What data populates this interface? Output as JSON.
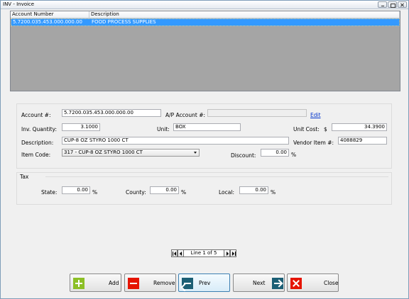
{
  "window": {
    "title": "INV - Invoice"
  },
  "grid": {
    "columns": [
      "Account Number",
      "Description"
    ],
    "rows": [
      {
        "account_number": "5.7200.035.453.000.000.00",
        "description": "FOOD PROCESS SUPPLIES",
        "selected": true
      }
    ]
  },
  "form": {
    "account_label": "Account #:",
    "account_value": "5.7200.035.453.000.000.00",
    "ap_account_label": "A/P Account #:",
    "ap_account_value": "",
    "edit_link": "Edit",
    "inv_quantity_label": "Inv. Quantity:",
    "inv_quantity_value": "3.1000",
    "unit_label": "Unit:",
    "unit_value": "BOX",
    "unit_cost_label": "Unit Cost:",
    "unit_cost_currency": "$",
    "unit_cost_value": "34.3900",
    "description_label": "Description:",
    "description_value": "CUP-8 OZ STYRO  1000 CT",
    "vendor_item_label": "Vendor Item #:",
    "vendor_item_value": "4088829",
    "item_code_label": "Item Code:",
    "item_code_value": "317 - CUP-8 OZ STYRO  1000 CT",
    "discount_label": "Discount:",
    "discount_value": "0.00",
    "percent": "%"
  },
  "tax": {
    "legend": "Tax",
    "state_label": "State:",
    "state_value": "0.00",
    "county_label": "County:",
    "county_value": "0.00",
    "local_label": "Local:",
    "local_value": "0.00",
    "percent": "%"
  },
  "navigator": {
    "text": "Line 1 of 5"
  },
  "buttons": {
    "add": "Add",
    "remove": "Remove",
    "prev": "Prev",
    "next": "Next",
    "close": "Close"
  },
  "colors": {
    "selection": "#3399ff",
    "grid_background": "#a5a5a5",
    "add_icon": "#8cbf26",
    "remove_icon": "#e51400",
    "nav_icon": "#1b5f75",
    "link": "#0033cc"
  },
  "icons": {
    "add": "plus-icon",
    "remove": "minus-icon",
    "prev": "arrow-left-icon",
    "next": "arrow-right-icon",
    "close": "close-x-icon"
  }
}
